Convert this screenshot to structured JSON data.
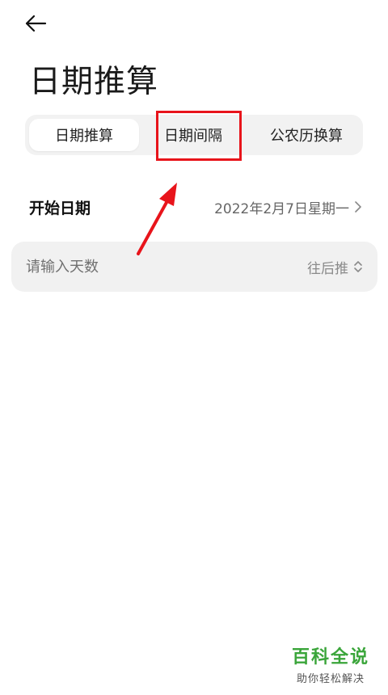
{
  "header": {
    "back_icon": "arrow-left-icon",
    "title": "日期推算"
  },
  "tabs": [
    {
      "label": "日期推算",
      "active": true
    },
    {
      "label": "日期间隔",
      "active": false,
      "highlighted": true
    },
    {
      "label": "公农历换算",
      "active": false
    }
  ],
  "start_date": {
    "label": "开始日期",
    "value": "2022年2月7日星期一",
    "icon": "chevron-right-icon"
  },
  "days_input": {
    "placeholder": "请输入天数",
    "value": "",
    "direction_label": "往后推",
    "direction_icon": "up-down-chevron-icon"
  },
  "annotation": {
    "highlight_color": "#e8141b",
    "arrow_color": "#e8141b"
  },
  "watermark": {
    "main": "百科全说",
    "sub": "助你轻松解决",
    "color": "#3aa53a"
  }
}
